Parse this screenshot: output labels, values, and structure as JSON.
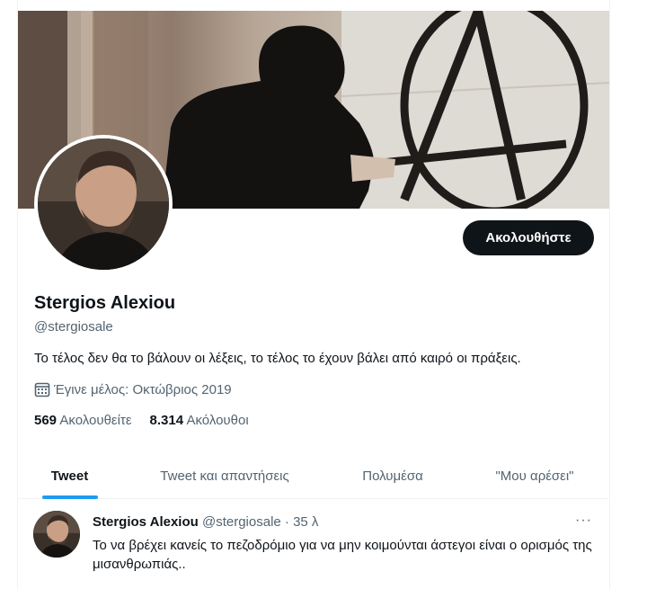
{
  "profile": {
    "name": "Stergios Alexiou",
    "handle": "@stergiosale",
    "bio": "Το τέλος δεν θα το βάλουν οι λέξεις, το τέλος το έχουν βάλει από καιρό οι πράξεις.",
    "joined": "Έγινε μέλος: Οκτώβριος 2019",
    "following_count": "569",
    "following_label": "Ακολουθείτε",
    "followers_count": "8.314",
    "followers_label": "Ακόλουθοι",
    "follow_button": "Ακολουθήστε"
  },
  "tabs": [
    {
      "label": "Tweet",
      "active": true
    },
    {
      "label": "Tweet και απαντήσεις",
      "active": false
    },
    {
      "label": "Πολυμέσα",
      "active": false
    },
    {
      "label": "\"Μου αρέσει\"",
      "active": false
    }
  ],
  "tweet": {
    "name": "Stergios Alexiou",
    "meta": "@stergiosale · 35 λ",
    "text": "Το να βρέχει κανείς το πεζοδρόμιο για να μην κοιμούνται άστεγοι είναι ο ορισμός της μισανθρωπιάς..",
    "more": "···"
  },
  "colors": {
    "accent": "#1d9bf0",
    "text_primary": "#0f1419",
    "text_secondary": "#536471",
    "button_bg": "#0f1419"
  },
  "icons": {
    "calendar": "calendar-icon",
    "more": "more-icon"
  }
}
